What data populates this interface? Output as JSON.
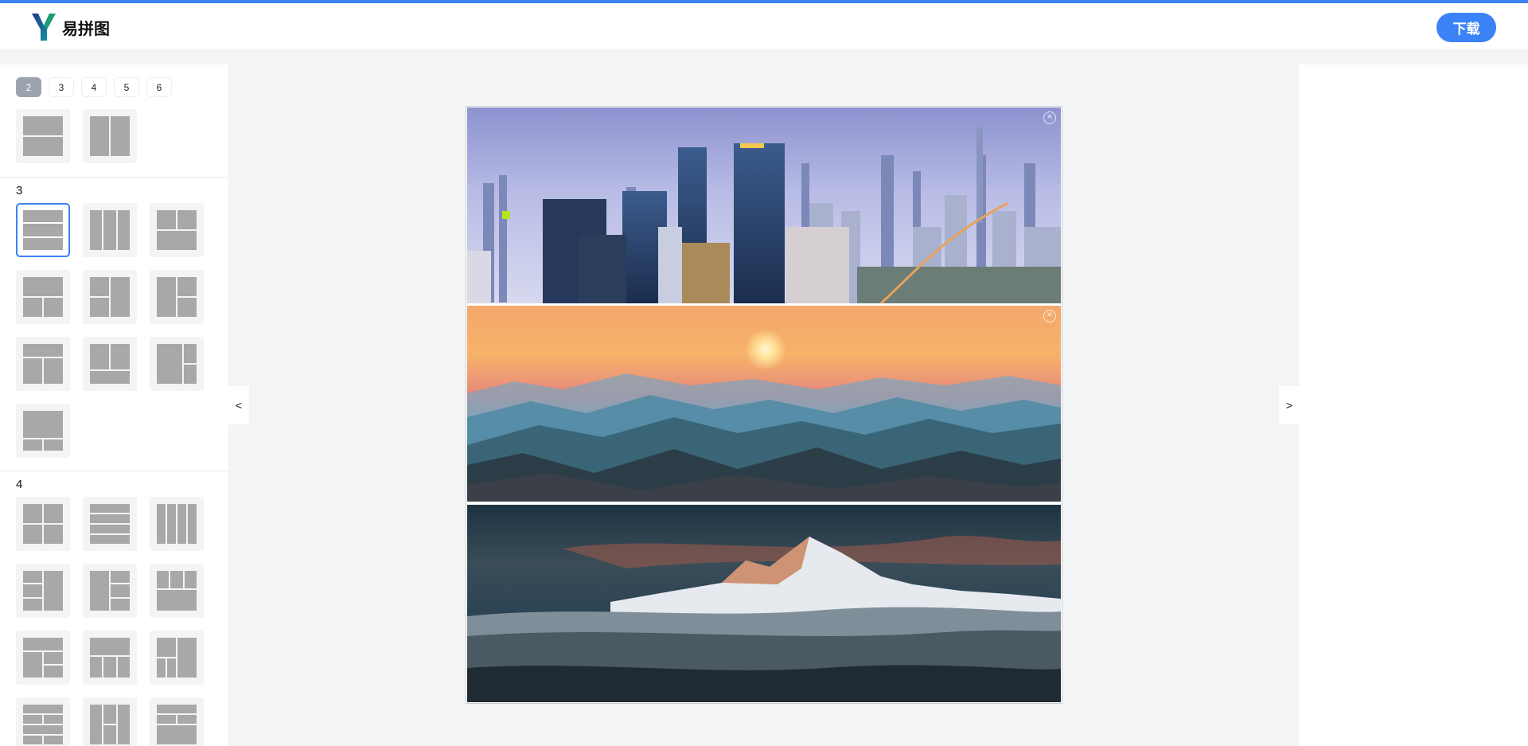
{
  "app": {
    "brand": "易拼图"
  },
  "header": {
    "download_label": "下载"
  },
  "sidebar": {
    "count_tabs": [
      "2",
      "3",
      "4",
      "5",
      "6"
    ],
    "active_count": "2",
    "sections": [
      {
        "title": ""
      },
      {
        "title": "3"
      },
      {
        "title": "4"
      }
    ]
  },
  "nav": {
    "prev": "<",
    "next": ">"
  },
  "canvas": {
    "photos": [
      {
        "subject": "city skyline",
        "close": "×"
      },
      {
        "subject": "sunrise over misty mountains",
        "close": "×"
      },
      {
        "subject": "snow peak above clouds"
      }
    ]
  },
  "icons": {
    "logo": "Y-logo-icon",
    "close": "close-circle-icon"
  },
  "colors": {
    "accent": "#3b82f6",
    "tile_bg": "#f3f4f6",
    "layout_block": "#a8a8a8"
  }
}
